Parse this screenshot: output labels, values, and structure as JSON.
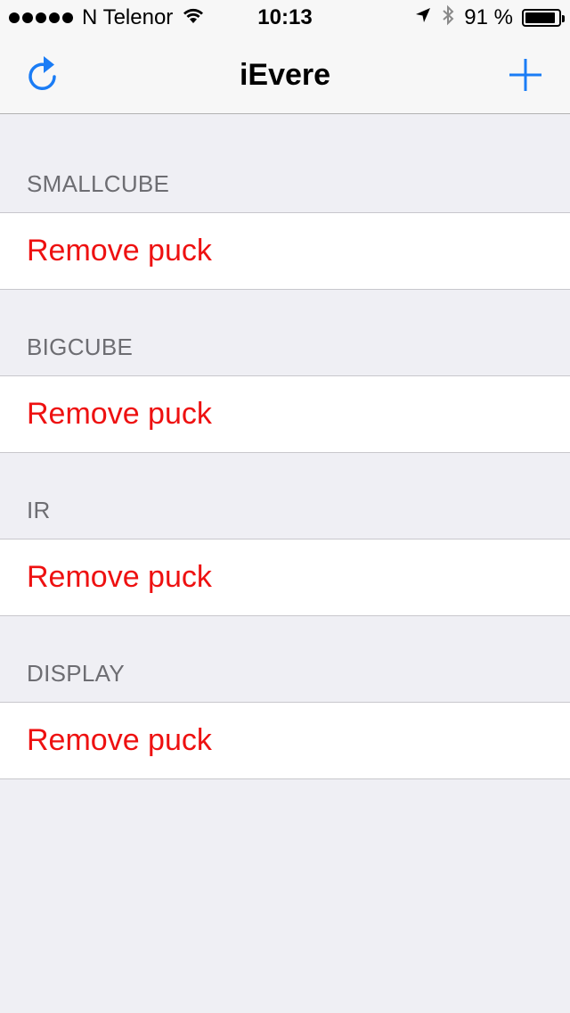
{
  "status_bar": {
    "carrier": "N Telenor",
    "time": "10:13",
    "battery": "91 %",
    "battery_level_fraction": 0.91,
    "icons": [
      "signal-dots-icon",
      "wifi-icon",
      "location-arrow-icon",
      "bluetooth-icon",
      "battery-icon"
    ]
  },
  "nav": {
    "title": "iEvere",
    "left_button_icon": "refresh-icon",
    "right_button_icon": "plus-icon"
  },
  "sections": [
    {
      "header": "SMALLCUBE",
      "cell_label": "Remove puck"
    },
    {
      "header": "BIGCUBE",
      "cell_label": "Remove puck"
    },
    {
      "header": "IR",
      "cell_label": "Remove puck"
    },
    {
      "header": "DISPLAY",
      "cell_label": "Remove puck"
    }
  ],
  "colors": {
    "tint": "#1a7cf5",
    "destructive": "#ee1111",
    "background": "#efeff4",
    "header_text": "#6d6d72"
  }
}
